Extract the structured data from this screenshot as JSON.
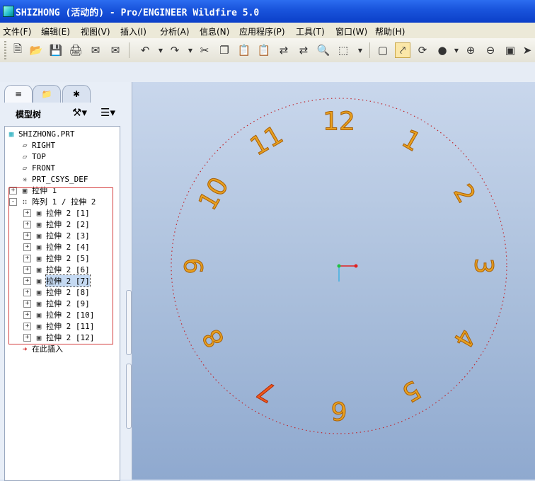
{
  "window": {
    "title": "SHIZHONG (活动的) - Pro/ENGINEER Wildfire 5.0"
  },
  "menu": [
    "文件(F)",
    "编辑(E)",
    "视图(V)",
    "插入(I)",
    "分析(A)",
    "信息(N)",
    "应用程序(P)",
    "工具(T)",
    "窗口(W)",
    "帮助(H)"
  ],
  "toolbar_icons": [
    "new-icon",
    "open-icon",
    "save-icon",
    "print-icon",
    "send-mail-icon",
    "send-mail-attach-icon",
    "undo-icon",
    "redo-icon",
    "cut-icon",
    "copy-icon",
    "paste-icon",
    "paste-special-icon",
    "regenerate-icon",
    "regen-manager-icon",
    "find-icon",
    "select-box-icon",
    "repaint-icon",
    "spin-center-icon",
    "orient-mode-icon",
    "display-style-icon",
    "zoom-in-icon",
    "zoom-out-icon",
    "refit-icon",
    "saved-views-icon"
  ],
  "navigator": {
    "tabs": [
      "model-tree-tab-icon",
      "folder-browser-tab-icon",
      "favorites-tab-icon"
    ],
    "label": "模型树"
  },
  "model_tree": [
    {
      "text": "SHIZHONG.PRT",
      "icon": "part-icon",
      "level": 0
    },
    {
      "text": "RIGHT",
      "icon": "datum-plane-icon",
      "level": 1
    },
    {
      "text": "TOP",
      "icon": "datum-plane-icon",
      "level": 1
    },
    {
      "text": "FRONT",
      "icon": "datum-plane-icon",
      "level": 1
    },
    {
      "text": "PRT_CSYS_DEF",
      "icon": "csys-icon",
      "level": 1
    },
    {
      "text": "拉伸 1",
      "icon": "extrude-icon",
      "level": 1,
      "expander": "+"
    },
    {
      "text": "阵列 1 / 拉伸 2",
      "icon": "pattern-icon",
      "level": 1,
      "expander": "-"
    },
    {
      "text": "拉伸 2 [1]",
      "icon": "extrude-icon",
      "level": 2,
      "expander": "+"
    },
    {
      "text": "拉伸 2 [2]",
      "icon": "extrude-icon",
      "level": 2,
      "expander": "+"
    },
    {
      "text": "拉伸 2 [3]",
      "icon": "extrude-icon",
      "level": 2,
      "expander": "+"
    },
    {
      "text": "拉伸 2 [4]",
      "icon": "extrude-icon",
      "level": 2,
      "expander": "+"
    },
    {
      "text": "拉伸 2 [5]",
      "icon": "extrude-icon",
      "level": 2,
      "expander": "+"
    },
    {
      "text": "拉伸 2 [6]",
      "icon": "extrude-icon",
      "level": 2,
      "expander": "+"
    },
    {
      "text": "拉伸 2 [7]",
      "icon": "extrude-icon",
      "level": 2,
      "expander": "+",
      "selected": true
    },
    {
      "text": "拉伸 2 [8]",
      "icon": "extrude-icon",
      "level": 2,
      "expander": "+"
    },
    {
      "text": "拉伸 2 [9]",
      "icon": "extrude-icon",
      "level": 2,
      "expander": "+"
    },
    {
      "text": "拉伸 2 [10]",
      "icon": "extrude-icon",
      "level": 2,
      "expander": "+"
    },
    {
      "text": "拉伸 2 [11]",
      "icon": "extrude-icon",
      "level": 2,
      "expander": "+"
    },
    {
      "text": "拉伸 2 [12]",
      "icon": "extrude-icon",
      "level": 2,
      "expander": "+"
    },
    {
      "text": "在此插入",
      "icon": "insert-here-arrow-icon",
      "level": 1
    }
  ],
  "clock_numbers": [
    "1",
    "2",
    "3",
    "4",
    "5",
    "6",
    "7",
    "8",
    "9",
    "10",
    "11",
    "12"
  ],
  "colors": {
    "title_bar": "#0b3fc8",
    "numeral_fill": "#e8a020",
    "numeral_highlight": "#f05a1a",
    "circle_dash": "#c0282e",
    "selection_box": "#d43c3c",
    "csys_x": "#e02020",
    "csys_origin": "#20c040",
    "csys_y": "#40b0e0"
  }
}
